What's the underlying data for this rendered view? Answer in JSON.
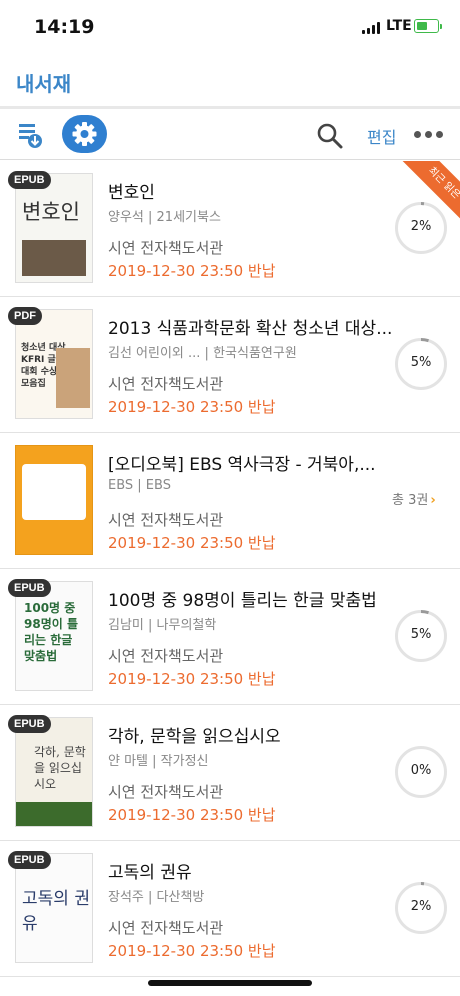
{
  "status_bar": {
    "time": "14:19",
    "network": "LTE"
  },
  "header": {
    "title": "내서재"
  },
  "toolbar": {
    "edit_label": "편집"
  },
  "colors": {
    "accent": "#3b86c8",
    "due": "#ec6b2f",
    "ribbon": "#ec6b2f"
  },
  "books": [
    {
      "format": "EPUB",
      "title": "변호인",
      "meta": "양우석 | 21세기북스",
      "library": "시연 전자책도서관",
      "due": "2019-12-30 23:50 반납",
      "progress": "2%",
      "ribbon": "최근 읽은 책",
      "cover_text": "변호인"
    },
    {
      "format": "PDF",
      "title": "2013 식품과학문화 확산 청소년 대상...",
      "meta": "김선 어린이외 ... | 한국식품연구원",
      "library": "시연 전자책도서관",
      "due": "2019-12-30 23:50 반납",
      "progress": "5%",
      "cover_text": "청소년 대상 KFRI 글쓰기대회 수상작 모음집"
    },
    {
      "format": "",
      "title": "[오디오북] EBS 역사극장 - 거북아,...",
      "meta": "EBS | EBS",
      "library": "시연 전자책도서관",
      "due": "2019-12-30 23:50 반납",
      "volumes": "총 3권"
    },
    {
      "format": "EPUB",
      "title": "100명 중 98명이 틀리는 한글 맞춤법",
      "meta": "김남미 | 나무의철학",
      "library": "시연 전자책도서관",
      "due": "2019-12-30 23:50 반납",
      "progress": "5%",
      "cover_text": "100명 중 98명이 틀리는 한글 맞춤법"
    },
    {
      "format": "EPUB",
      "title": "각하, 문학을 읽으십시오",
      "meta": "얀 마텔 | 작가정신",
      "library": "시연 전자책도서관",
      "due": "2019-12-30 23:50 반납",
      "progress": "0%",
      "cover_text": "각하, 문학을 읽으십시오"
    },
    {
      "format": "EPUB",
      "title": "고독의 권유",
      "meta": "장석주 | 다산책방",
      "library": "시연 전자책도서관",
      "due": "2019-12-30 23:50 반납",
      "progress": "2%",
      "cover_text": "고독의 권유"
    }
  ]
}
